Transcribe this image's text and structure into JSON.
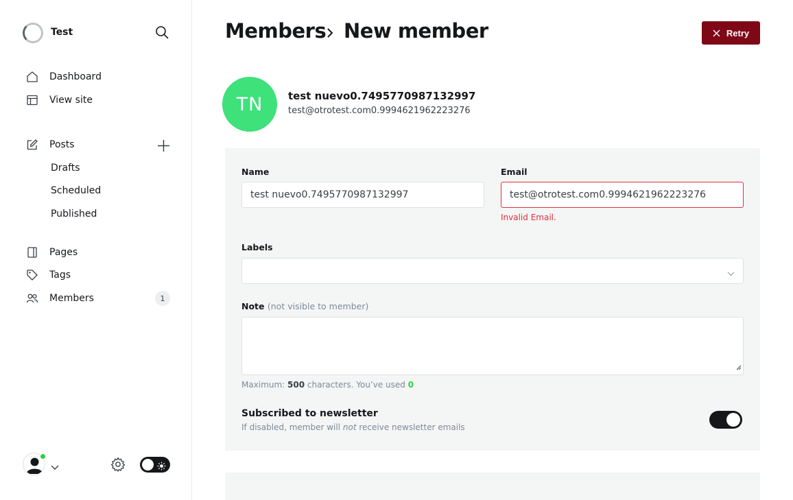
{
  "site": {
    "title": "Test"
  },
  "nav": {
    "dashboard": "Dashboard",
    "view_site": "View site",
    "posts": "Posts",
    "drafts": "Drafts",
    "scheduled": "Scheduled",
    "published": "Published",
    "pages": "Pages",
    "tags": "Tags",
    "members": "Members",
    "members_count": "1"
  },
  "header": {
    "breadcrumb_parent": "Members",
    "breadcrumb_current": "New member",
    "retry_label": "Retry"
  },
  "member": {
    "initials": "TN",
    "name": "test nuevo0.7495770987132997",
    "email": "test@otrotest.com0.9994621962223276"
  },
  "form": {
    "name_label": "Name",
    "name_value": "test nuevo0.7495770987132997",
    "email_label": "Email",
    "email_value": "test@otrotest.com0.9994621962223276",
    "email_error": "Invalid Email.",
    "labels_label": "Labels",
    "labels_value": "",
    "note_label": "Note",
    "note_muted": "(not visible to member)",
    "note_value": "",
    "hint_prefix": "Maximum:",
    "hint_max": "500",
    "hint_mid": "characters. You’ve used",
    "hint_used": "0",
    "newsletter_title": "Subscribed to newsletter",
    "newsletter_desc_1": "If disabled, member will",
    "newsletter_desc_em": "not",
    "newsletter_desc_2": "receive newsletter emails",
    "newsletter_enabled": true
  },
  "colors": {
    "accent_error": "#e52e3a",
    "retry_button": "#7f0816",
    "avatar": "#3ee17a",
    "status_online": "#30cf43"
  }
}
